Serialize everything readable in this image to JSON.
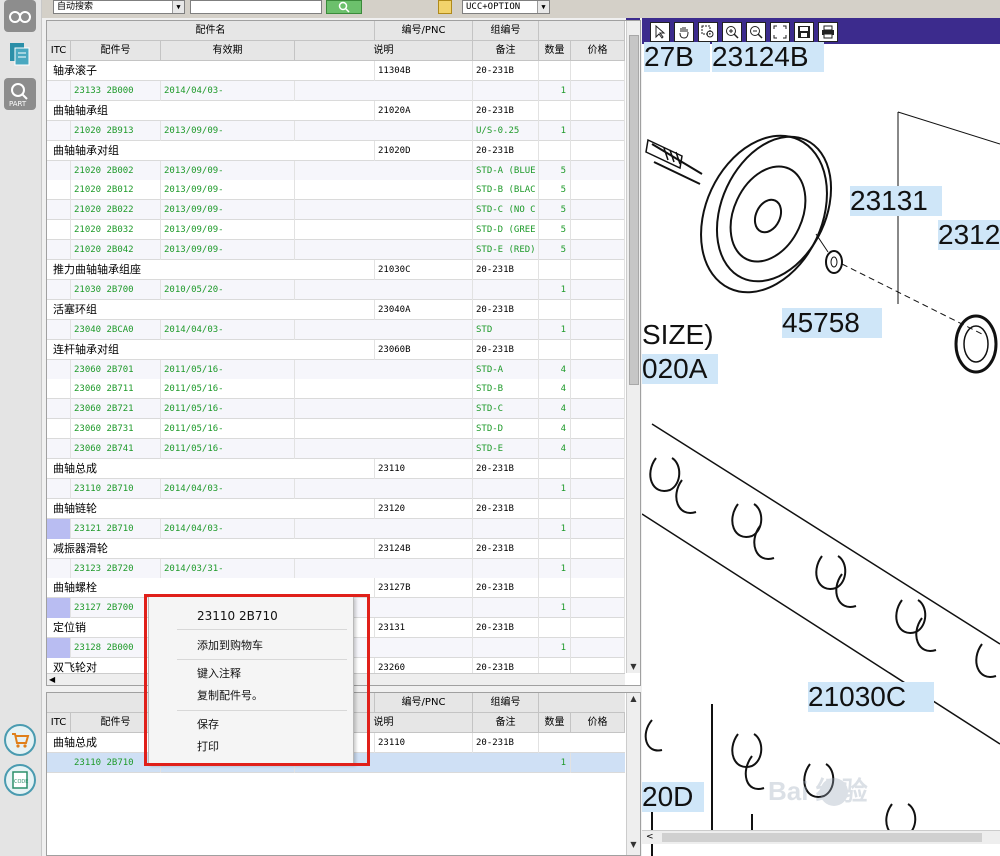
{
  "toolbar": {
    "search_mode": "自动搜索",
    "search_value": "",
    "model_filter": "UCC+OPTION"
  },
  "columns": {
    "group1": "配件名",
    "group2": "编号/PNC",
    "group3": "组编号",
    "itc": "ITC",
    "part_no": "配件号",
    "validity": "有效期",
    "description": "说明",
    "remark": "备注",
    "qty": "数量",
    "price": "价格"
  },
  "rows": [
    {
      "type": "group",
      "name": "轴承滚子",
      "pnc": "11304B",
      "group": "20-231B"
    },
    {
      "type": "part",
      "part_no": "23133 2B000",
      "validity": "2014/04/03-",
      "remark": "",
      "qty": "1"
    },
    {
      "type": "group",
      "name": "曲轴轴承组",
      "pnc": "21020A",
      "group": "20-231B"
    },
    {
      "type": "part",
      "part_no": "21020 2B913",
      "validity": "2013/09/09-",
      "remark": "U/S-0.25",
      "qty": "1"
    },
    {
      "type": "group",
      "name": "曲轴轴承对组",
      "pnc": "21020D",
      "group": "20-231B"
    },
    {
      "type": "part",
      "part_no": "21020 2B002",
      "validity": "2013/09/09-",
      "remark": "STD-A (BLUE",
      "qty": "5"
    },
    {
      "type": "part",
      "part_no": "21020 2B012",
      "validity": "2013/09/09-",
      "remark": "STD-B (BLAC",
      "qty": "5"
    },
    {
      "type": "part",
      "part_no": "21020 2B022",
      "validity": "2013/09/09-",
      "remark": "STD-C (NO C",
      "qty": "5"
    },
    {
      "type": "part",
      "part_no": "21020 2B032",
      "validity": "2013/09/09-",
      "remark": "STD-D (GREE",
      "qty": "5"
    },
    {
      "type": "part",
      "part_no": "21020 2B042",
      "validity": "2013/09/09-",
      "remark": "STD-E (RED)",
      "qty": "5"
    },
    {
      "type": "group",
      "name": "推力曲轴轴承组座",
      "pnc": "21030C",
      "group": "20-231B"
    },
    {
      "type": "part",
      "part_no": "21030 2B700",
      "validity": "2010/05/20-",
      "remark": "",
      "qty": "1"
    },
    {
      "type": "group",
      "name": "活塞环组",
      "pnc": "23040A",
      "group": "20-231B"
    },
    {
      "type": "part",
      "part_no": "23040 2BCA0",
      "validity": "2014/04/03-",
      "remark": "STD",
      "qty": "1"
    },
    {
      "type": "group",
      "name": "连杆轴承对组",
      "pnc": "23060B",
      "group": "20-231B"
    },
    {
      "type": "part",
      "part_no": "23060 2B701",
      "validity": "2011/05/16-",
      "remark": "STD-A",
      "qty": "4"
    },
    {
      "type": "part",
      "part_no": "23060 2B711",
      "validity": "2011/05/16-",
      "remark": "STD-B",
      "qty": "4"
    },
    {
      "type": "part",
      "part_no": "23060 2B721",
      "validity": "2011/05/16-",
      "remark": "STD-C",
      "qty": "4"
    },
    {
      "type": "part",
      "part_no": "23060 2B731",
      "validity": "2011/05/16-",
      "remark": "STD-D",
      "qty": "4"
    },
    {
      "type": "part",
      "part_no": "23060 2B741",
      "validity": "2011/05/16-",
      "remark": "STD-E",
      "qty": "4"
    },
    {
      "type": "group",
      "name": "曲轴总成",
      "pnc": "23110",
      "group": "20-231B"
    },
    {
      "type": "part",
      "part_no": "23110 2B710",
      "validity": "2014/04/03-",
      "remark": "",
      "qty": "1"
    },
    {
      "type": "group",
      "name": "曲轴链轮",
      "pnc": "23120",
      "group": "20-231B"
    },
    {
      "type": "part",
      "part_no": "23121 2B710",
      "validity": "2014/04/03-",
      "remark": "",
      "qty": "1",
      "marked": true
    },
    {
      "type": "group",
      "name": "减振器滑轮",
      "pnc": "23124B",
      "group": "20-231B"
    },
    {
      "type": "part",
      "part_no": "23123 2B720",
      "validity": "2014/03/31-",
      "remark": "",
      "qty": "1"
    },
    {
      "type": "group",
      "name": "曲轴螺栓",
      "pnc": "23127B",
      "group": "20-231B"
    },
    {
      "type": "part",
      "part_no": "23127 2B700",
      "validity": "",
      "remark": "",
      "qty": "1",
      "marked": true
    },
    {
      "type": "group",
      "name": "定位销",
      "pnc": "23131",
      "group": "20-231B"
    },
    {
      "type": "part",
      "part_no": "23128 2B000",
      "validity": "",
      "remark": "",
      "qty": "1",
      "marked": true
    },
    {
      "type": "group",
      "name": "双飞轮对",
      "pnc": "23260",
      "group": "20-231B"
    }
  ],
  "selected": {
    "group_name": "曲轴总成",
    "pnc": "23110",
    "group": "20-231B",
    "part_no": "23110 2B710",
    "validity": "2014/04/03-",
    "qty": "1"
  },
  "context_menu": {
    "title": "23110 2B710",
    "items": [
      "添加到购物车",
      "键入注释",
      "复制配件号。",
      "保存",
      "打印"
    ]
  },
  "diagram": {
    "callouts": [
      "27B",
      "23124B",
      "23131",
      "2312",
      "45758",
      "SIZE)",
      "020A",
      "21030C",
      "20D"
    ],
    "watermark": "Bai 经验"
  },
  "colors": {
    "accent_purple": "#3c2b8d",
    "part_green": "#1e9a2a",
    "callout_bg": "#cfe6f8",
    "highlight_red": "#e0201a"
  }
}
